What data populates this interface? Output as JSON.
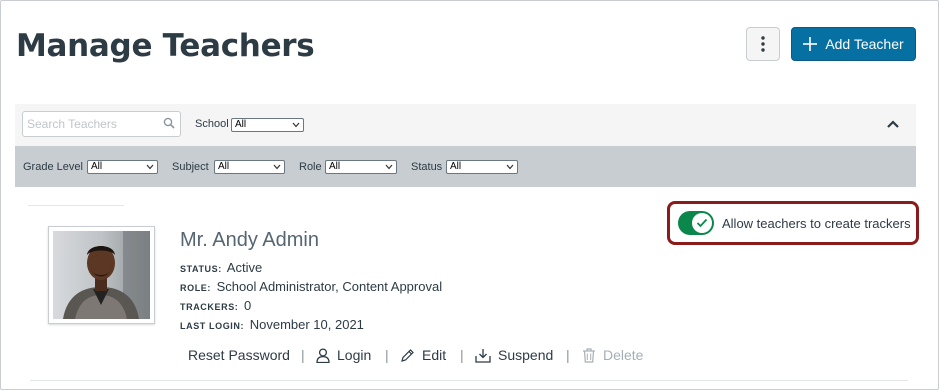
{
  "page": {
    "title": "Manage Teachers"
  },
  "header": {
    "add_button_label": "Add Teacher",
    "more_options_icon": "kebab-vertical-icon",
    "add_icon": "plus-icon"
  },
  "filters": {
    "search_placeholder": "Search Teachers",
    "school": {
      "label": "School",
      "value": "All"
    },
    "grade_level": {
      "label": "Grade Level",
      "value": "All"
    },
    "subject": {
      "label": "Subject",
      "value": "All"
    },
    "role": {
      "label": "Role",
      "value": "All"
    },
    "status": {
      "label": "Status",
      "value": "All"
    }
  },
  "settings": {
    "allow_trackers_label": "Allow teachers to create trackers",
    "allow_trackers_enabled": true
  },
  "teacher": {
    "name": "Mr. Andy Admin",
    "status_key": "STATUS:",
    "status": "Active",
    "role_key": "ROLE:",
    "role": "School Administrator, Content Approval",
    "trackers_key": "TRACKERS:",
    "trackers": "0",
    "last_login_key": "LAST LOGIN:",
    "last_login": "November 10, 2021"
  },
  "actions": {
    "reset_password": "Reset Password",
    "login": "Login",
    "edit": "Edit",
    "suspend": "Suspend",
    "delete": "Delete",
    "separator": "|"
  },
  "colors": {
    "primary": "#0770a3",
    "toggle_on": "#0b874b",
    "highlight_border": "#8b1a1a",
    "filter_bg": "#f5f5f5",
    "filter_bar_dark": "#c7cdd1"
  }
}
